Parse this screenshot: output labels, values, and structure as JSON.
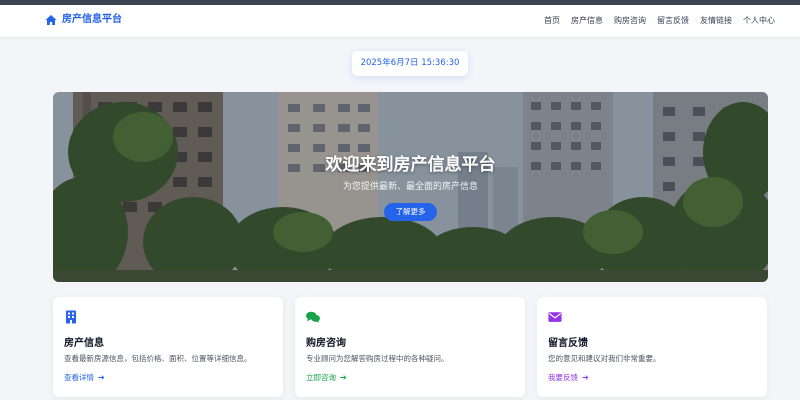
{
  "nav": {
    "brand": "房产信息平台",
    "links": [
      "首页",
      "房产信息",
      "购房咨询",
      "留言反馈",
      "友情链接",
      "个人中心"
    ]
  },
  "clock": {
    "text": "2025年6月7日 15:36:30"
  },
  "hero": {
    "title": "欢迎来到房产信息平台",
    "subtitle": "为您提供最新、最全面的房产信息",
    "button": "了解更多"
  },
  "cards": [
    {
      "icon": "building-icon",
      "title": "房产信息",
      "desc": "查看最新房源信息，包括价格、面积、位置等详细信息。",
      "link": "查看详情",
      "color": "#2563eb"
    },
    {
      "icon": "chat-icon",
      "title": "购房咨询",
      "desc": "专业顾问为您解答购房过程中的各种疑问。",
      "link": "立即咨询",
      "color": "#16a34a"
    },
    {
      "icon": "envelope-icon",
      "title": "留言反馈",
      "desc": "您的意见和建议对我们非常重要。",
      "link": "我要反馈",
      "color": "#9333ea"
    }
  ],
  "colors": {
    "accent": "#2563eb",
    "green": "#16a34a",
    "purple": "#9333ea"
  }
}
